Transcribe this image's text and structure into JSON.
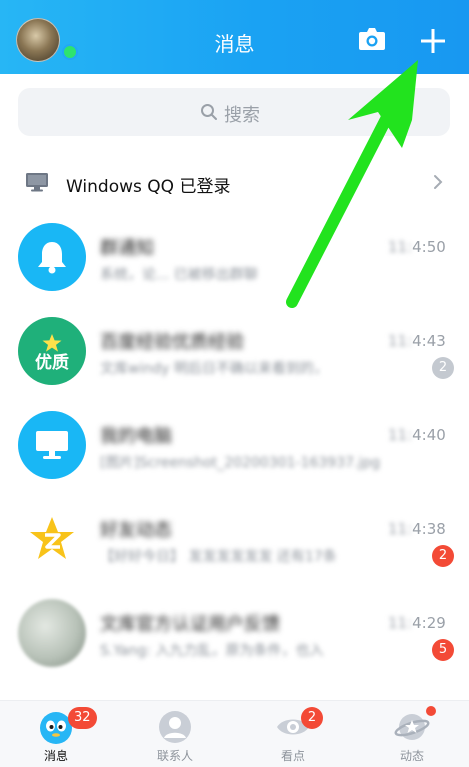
{
  "header": {
    "title": "消息",
    "camera_icon": "camera-icon",
    "plus_icon": "plus-icon",
    "status": "online"
  },
  "search": {
    "placeholder": "搜索",
    "icon": "search-icon"
  },
  "device_login": {
    "label": "Windows QQ 已登录",
    "icon": "monitor-icon"
  },
  "chats": [
    {
      "name": "群通知",
      "message": "系统，论... 已被移出群聊",
      "time_hidden": "11:",
      "time_visible": "4:50",
      "badge": "",
      "icon": "bell-icon",
      "avatar_color": "#19b7f5"
    },
    {
      "name": "百度经验优质经验",
      "message": "文库windy 明后日不确以来看到的，",
      "time_hidden": "11:",
      "time_visible": "4:43",
      "badge": "2",
      "icon": "star-icon",
      "avatar_text": "优质",
      "avatar_color": "#1fb07a"
    },
    {
      "name": "我的电脑",
      "message": "[图片]Screenshot_20200301-163937.jpg",
      "time_hidden": "11:",
      "time_visible": "4:40",
      "badge": "",
      "icon": "computer-icon",
      "avatar_color": "#19b7f5"
    },
    {
      "name": "好友动态",
      "message": "【好好今日】 发发发发发发 还有17条",
      "time_hidden": "11:",
      "time_visible": "4:38",
      "badge": "2",
      "icon": "qzone-star-icon",
      "avatar_color": "#ffffff"
    },
    {
      "name": "文库官方认证用户反馈",
      "message": "S.Yang: 入九力乱，原为条件，也入",
      "time_hidden": "11:",
      "time_visible": "4:29",
      "badge": "5",
      "icon": "group-avatar-icon",
      "avatar_color": "#b8c2b8"
    }
  ],
  "bottom_nav": [
    {
      "label": "消息",
      "icon": "message-penguin-icon",
      "badge": "32",
      "active": true
    },
    {
      "label": "联系人",
      "icon": "contacts-icon",
      "badge": "",
      "active": false
    },
    {
      "label": "看点",
      "icon": "eye-icon",
      "badge": "2",
      "active": false
    },
    {
      "label": "动态",
      "icon": "planet-icon",
      "badge": "",
      "dot": true,
      "active": false
    }
  ],
  "colors": {
    "header_start": "#27b6f5",
    "header_end": "#1898f1",
    "badge_red": "#f34a36",
    "badge_grey": "#c4c9d0",
    "annotation_arrow": "#22e31e"
  }
}
